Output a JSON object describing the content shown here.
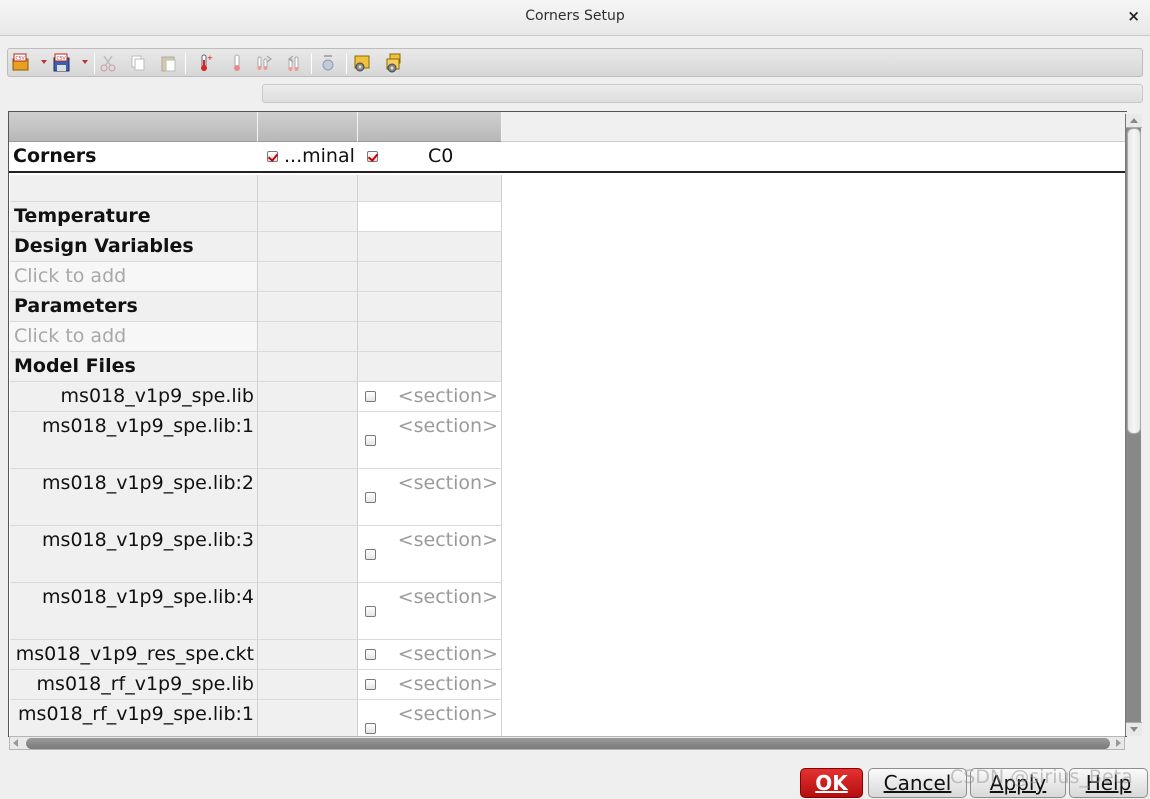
{
  "window": {
    "title": "Corners Setup",
    "close_glyph": "×"
  },
  "toolbar": {
    "icons": [
      "csv-open-icon",
      "csv-save-icon",
      "cut-icon",
      "copy-icon",
      "paste-icon",
      "add-temperature-icon",
      "add-variable-icon",
      "add-parameter-icon",
      "add-model-icon",
      "clear-icon",
      "setup-icon",
      "group-setup-icon"
    ]
  },
  "table": {
    "header_row_label": "Corners",
    "columns": [
      {
        "label": "...minal",
        "checked": true
      },
      {
        "label": "C0",
        "checked": true
      }
    ],
    "rows": {
      "temperature": "Temperature",
      "design_variables": "Design Variables",
      "design_variables_hint": "Click to add",
      "parameters": "Parameters",
      "parameters_hint": "Click to add",
      "model_files": "Model Files"
    },
    "section_placeholder": "<section>",
    "model_files": [
      {
        "name": "ms018_v1p9_spe.lib"
      },
      {
        "name": "ms018_v1p9_spe.lib:1"
      },
      {
        "name": "ms018_v1p9_spe.lib:2"
      },
      {
        "name": "ms018_v1p9_spe.lib:3"
      },
      {
        "name": "ms018_v1p9_spe.lib:4"
      },
      {
        "name": "ms018_v1p9_res_spe.ckt"
      },
      {
        "name": "ms018_rf_v1p9_spe.lib"
      },
      {
        "name": "ms018_rf_v1p9_spe.lib:1"
      }
    ]
  },
  "buttons": {
    "ok": "OK",
    "cancel": "Cancel",
    "apply": "Apply",
    "help": "Help"
  },
  "watermark": "CSDN @sirius_Beta",
  "colors": {
    "ok_button": "#c81818",
    "check_mark": "#cc0000",
    "header_gray": "#c4c4c4"
  }
}
